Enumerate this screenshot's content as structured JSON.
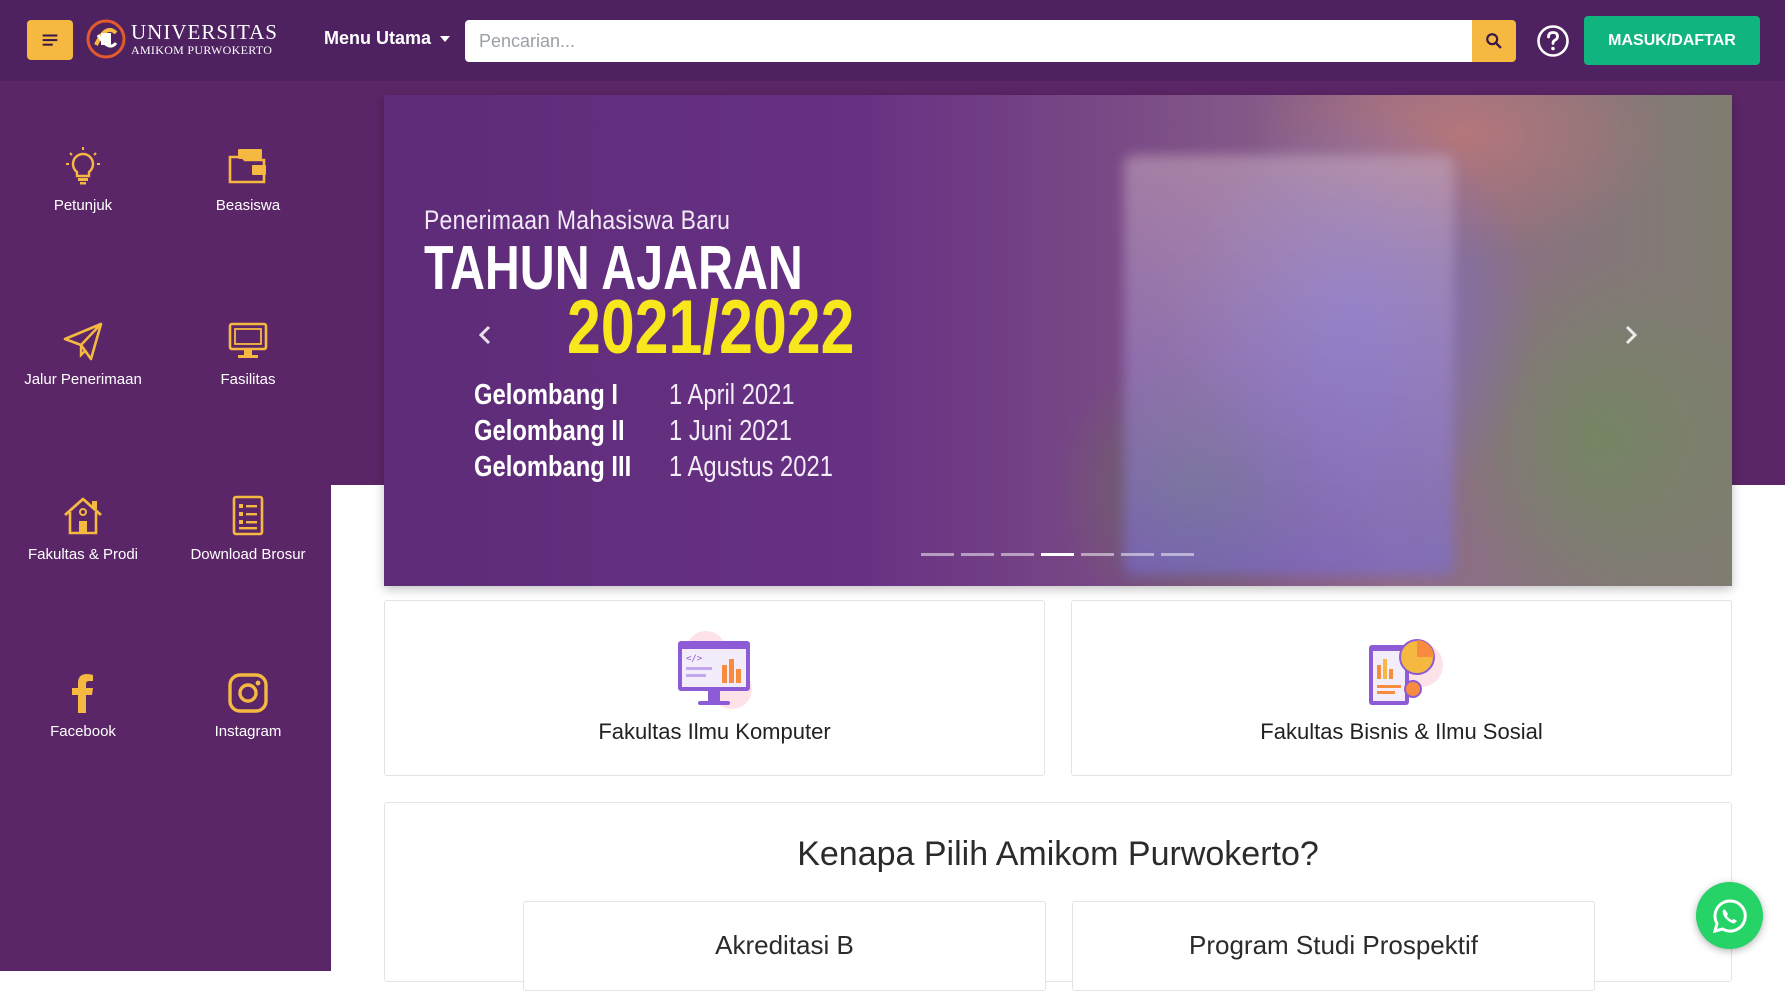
{
  "navbar": {
    "logo": {
      "line1": "UNIVERSITAS",
      "line2": "AMIKOM PURWOKERTO",
      "icon": "university-logo"
    },
    "menu_label": "Menu Utama",
    "search": {
      "placeholder": "Pencarian...",
      "value": ""
    },
    "login_label": "MASUK/DAFTAR",
    "help_icon": "question-circle-icon",
    "colors": {
      "bar": "#4e2160",
      "accent": "#f5b841",
      "login": "#0fb47f"
    }
  },
  "sidebar": {
    "items": [
      {
        "label": "Petunjuk",
        "icon": "lightbulb-icon"
      },
      {
        "label": "Beasiswa",
        "icon": "folder-icon"
      },
      {
        "label": "Jalur Penerimaan",
        "icon": "paper-plane-icon"
      },
      {
        "label": "Fasilitas",
        "icon": "monitor-icon"
      },
      {
        "label": "Fakultas & Prodi",
        "icon": "home-icon"
      },
      {
        "label": "Download Brosur",
        "icon": "checklist-icon"
      },
      {
        "label": "Facebook",
        "icon": "facebook-icon"
      },
      {
        "label": "Instagram",
        "icon": "instagram-icon"
      }
    ],
    "colors": {
      "bg": "#5b2667",
      "icon": "#f5b841"
    }
  },
  "hero": {
    "subtitle": "Penerimaan Mahasiswa Baru",
    "title": "TAHUN AJARAN",
    "year": "2021/2022",
    "waves": [
      {
        "name": "Gelombang I",
        "date": "1 April 2021"
      },
      {
        "name": "Gelombang II",
        "date": "1 Juni 2021"
      },
      {
        "name": "Gelombang III",
        "date": "1 Agustus 2021"
      }
    ],
    "slide_count": 7,
    "active_slide": 4,
    "year_color": "#f8e71c"
  },
  "faculties": [
    {
      "label": "Fakultas Ilmu Komputer",
      "icon": "computer-code-illustration"
    },
    {
      "label": "Fakultas Bisnis & Ilmu Sosial",
      "icon": "business-report-illustration"
    }
  ],
  "why": {
    "title": "Kenapa Pilih Amikom Purwokerto?",
    "cards": [
      {
        "label": "Akreditasi B"
      },
      {
        "label": "Program Studi Prospektif"
      }
    ]
  },
  "whatsapp": {
    "icon": "whatsapp-icon",
    "color": "#25d366"
  }
}
